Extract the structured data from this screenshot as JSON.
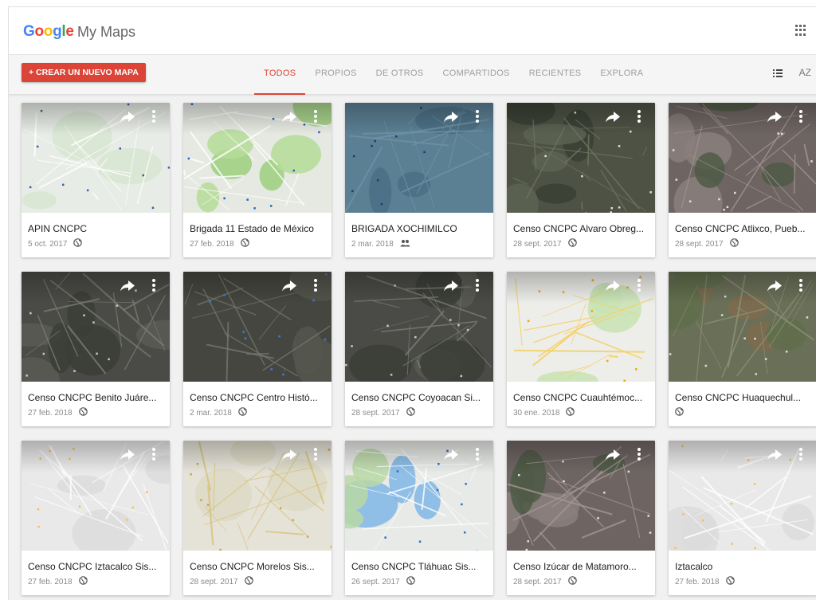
{
  "app": {
    "brand": [
      "G",
      "o",
      "o",
      "g",
      "l",
      "e"
    ],
    "name": "My Maps"
  },
  "toolbar": {
    "create_label": "+ CREAR UN NUEVO MAPA",
    "tabs": [
      "TODOS",
      "PROPIOS",
      "DE OTROS",
      "COMPARTIDOS",
      "RECIENTES",
      "EXPLORA"
    ],
    "active_tab": "TODOS",
    "sort_label": "AZ",
    "colors": {
      "accent": "#db4437"
    }
  },
  "maps": [
    {
      "title": "APIN CNCPC",
      "date": "5 oct. 2017",
      "visibility": "globe-icon",
      "style": "road-light"
    },
    {
      "title": "Brigada 11 Estado de México",
      "date": "27 feb. 2018",
      "visibility": "globe-icon",
      "style": "road-green"
    },
    {
      "title": "BRIGADA XOCHIMILCO",
      "date": "2 mar. 2018",
      "visibility": "people-icon",
      "style": "blue-dark"
    },
    {
      "title": "Censo CNCPC Alvaro Obreg...",
      "date": "28 sept. 2017",
      "visibility": "globe-icon",
      "style": "satellite-terrain"
    },
    {
      "title": "Censo CNCPC Atlixco, Pueb...",
      "date": "28 sept. 2017",
      "visibility": "globe-icon",
      "style": "satellite-town"
    },
    {
      "title": "Censo CNCPC Benito Juáre...",
      "date": "27 feb. 2018",
      "visibility": "globe-icon",
      "style": "satellite-city"
    },
    {
      "title": "Censo CNCPC Centro Histó...",
      "date": "2 mar. 2018",
      "visibility": "globe-icon",
      "style": "satellite-city-routes"
    },
    {
      "title": "Censo CNCPC Coyoacan Si...",
      "date": "28 sept. 2017",
      "visibility": "globe-icon",
      "style": "satellite-city"
    },
    {
      "title": "Censo CNCPC Cuauhtémoc...",
      "date": "30 ene. 2018",
      "visibility": "globe-icon",
      "style": "road-yellow"
    },
    {
      "title": "Censo CNCPC Huaquechul...",
      "date": "",
      "visibility": "globe-icon",
      "style": "satellite-rural"
    },
    {
      "title": "Censo CNCPC Iztacalco Sis...",
      "date": "27 feb. 2018",
      "visibility": "globe-icon",
      "style": "road-grey"
    },
    {
      "title": "Censo CNCPC Morelos Sis...",
      "date": "28 sept. 2017",
      "visibility": "globe-icon",
      "style": "road-beige"
    },
    {
      "title": "Censo CNCPC Tláhuac Sis...",
      "date": "26 sept. 2017",
      "visibility": "globe-icon",
      "style": "road-water"
    },
    {
      "title": "Censo Izúcar de Matamoro...",
      "date": "28 sept. 2017",
      "visibility": "globe-icon",
      "style": "satellite-town"
    },
    {
      "title": "Iztacalco",
      "date": "27 feb. 2018",
      "visibility": "globe-icon",
      "style": "road-grey"
    }
  ]
}
